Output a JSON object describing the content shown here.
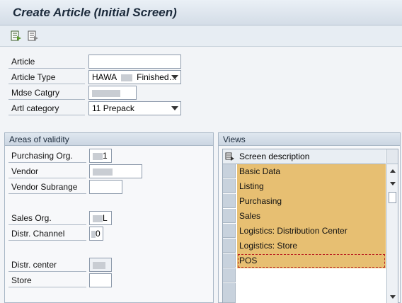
{
  "window": {
    "title": "Create Article (Initial Screen)"
  },
  "toolbar": {
    "buttons": [
      {
        "icon": "select-views-icon"
      },
      {
        "icon": "org-levels-icon"
      }
    ]
  },
  "form": {
    "article_label": "Article",
    "article_value": "",
    "article_type_label": "Article Type",
    "article_type_value": "HAWA",
    "article_type_text": "Finished…",
    "mdse_catgry_label": "Mdse Catgry",
    "artl_category_label": "Artl category",
    "artl_category_value": "11 Prepack"
  },
  "areas": {
    "title": "Areas of validity",
    "purchasing_org_label": "Purchasing Org.",
    "purchasing_org_suffix": "1",
    "vendor_label": "Vendor",
    "vendor_subrange_label": "Vendor Subrange",
    "sales_org_label": "Sales Org.",
    "sales_org_suffix": "L",
    "distr_channel_label": "Distr. Channel",
    "distr_channel_suffix": "0",
    "distr_center_label": "Distr. center",
    "store_label": "Store"
  },
  "views": {
    "title": "Views",
    "column_header": "Screen description",
    "items": [
      "Basic Data",
      "Listing",
      "Purchasing",
      "Sales",
      "Logistics: Distribution Center",
      "Logistics: Store",
      "POS"
    ]
  },
  "colors": {
    "highlight": "#e7bf72",
    "title_text": "#1b2a3b"
  }
}
